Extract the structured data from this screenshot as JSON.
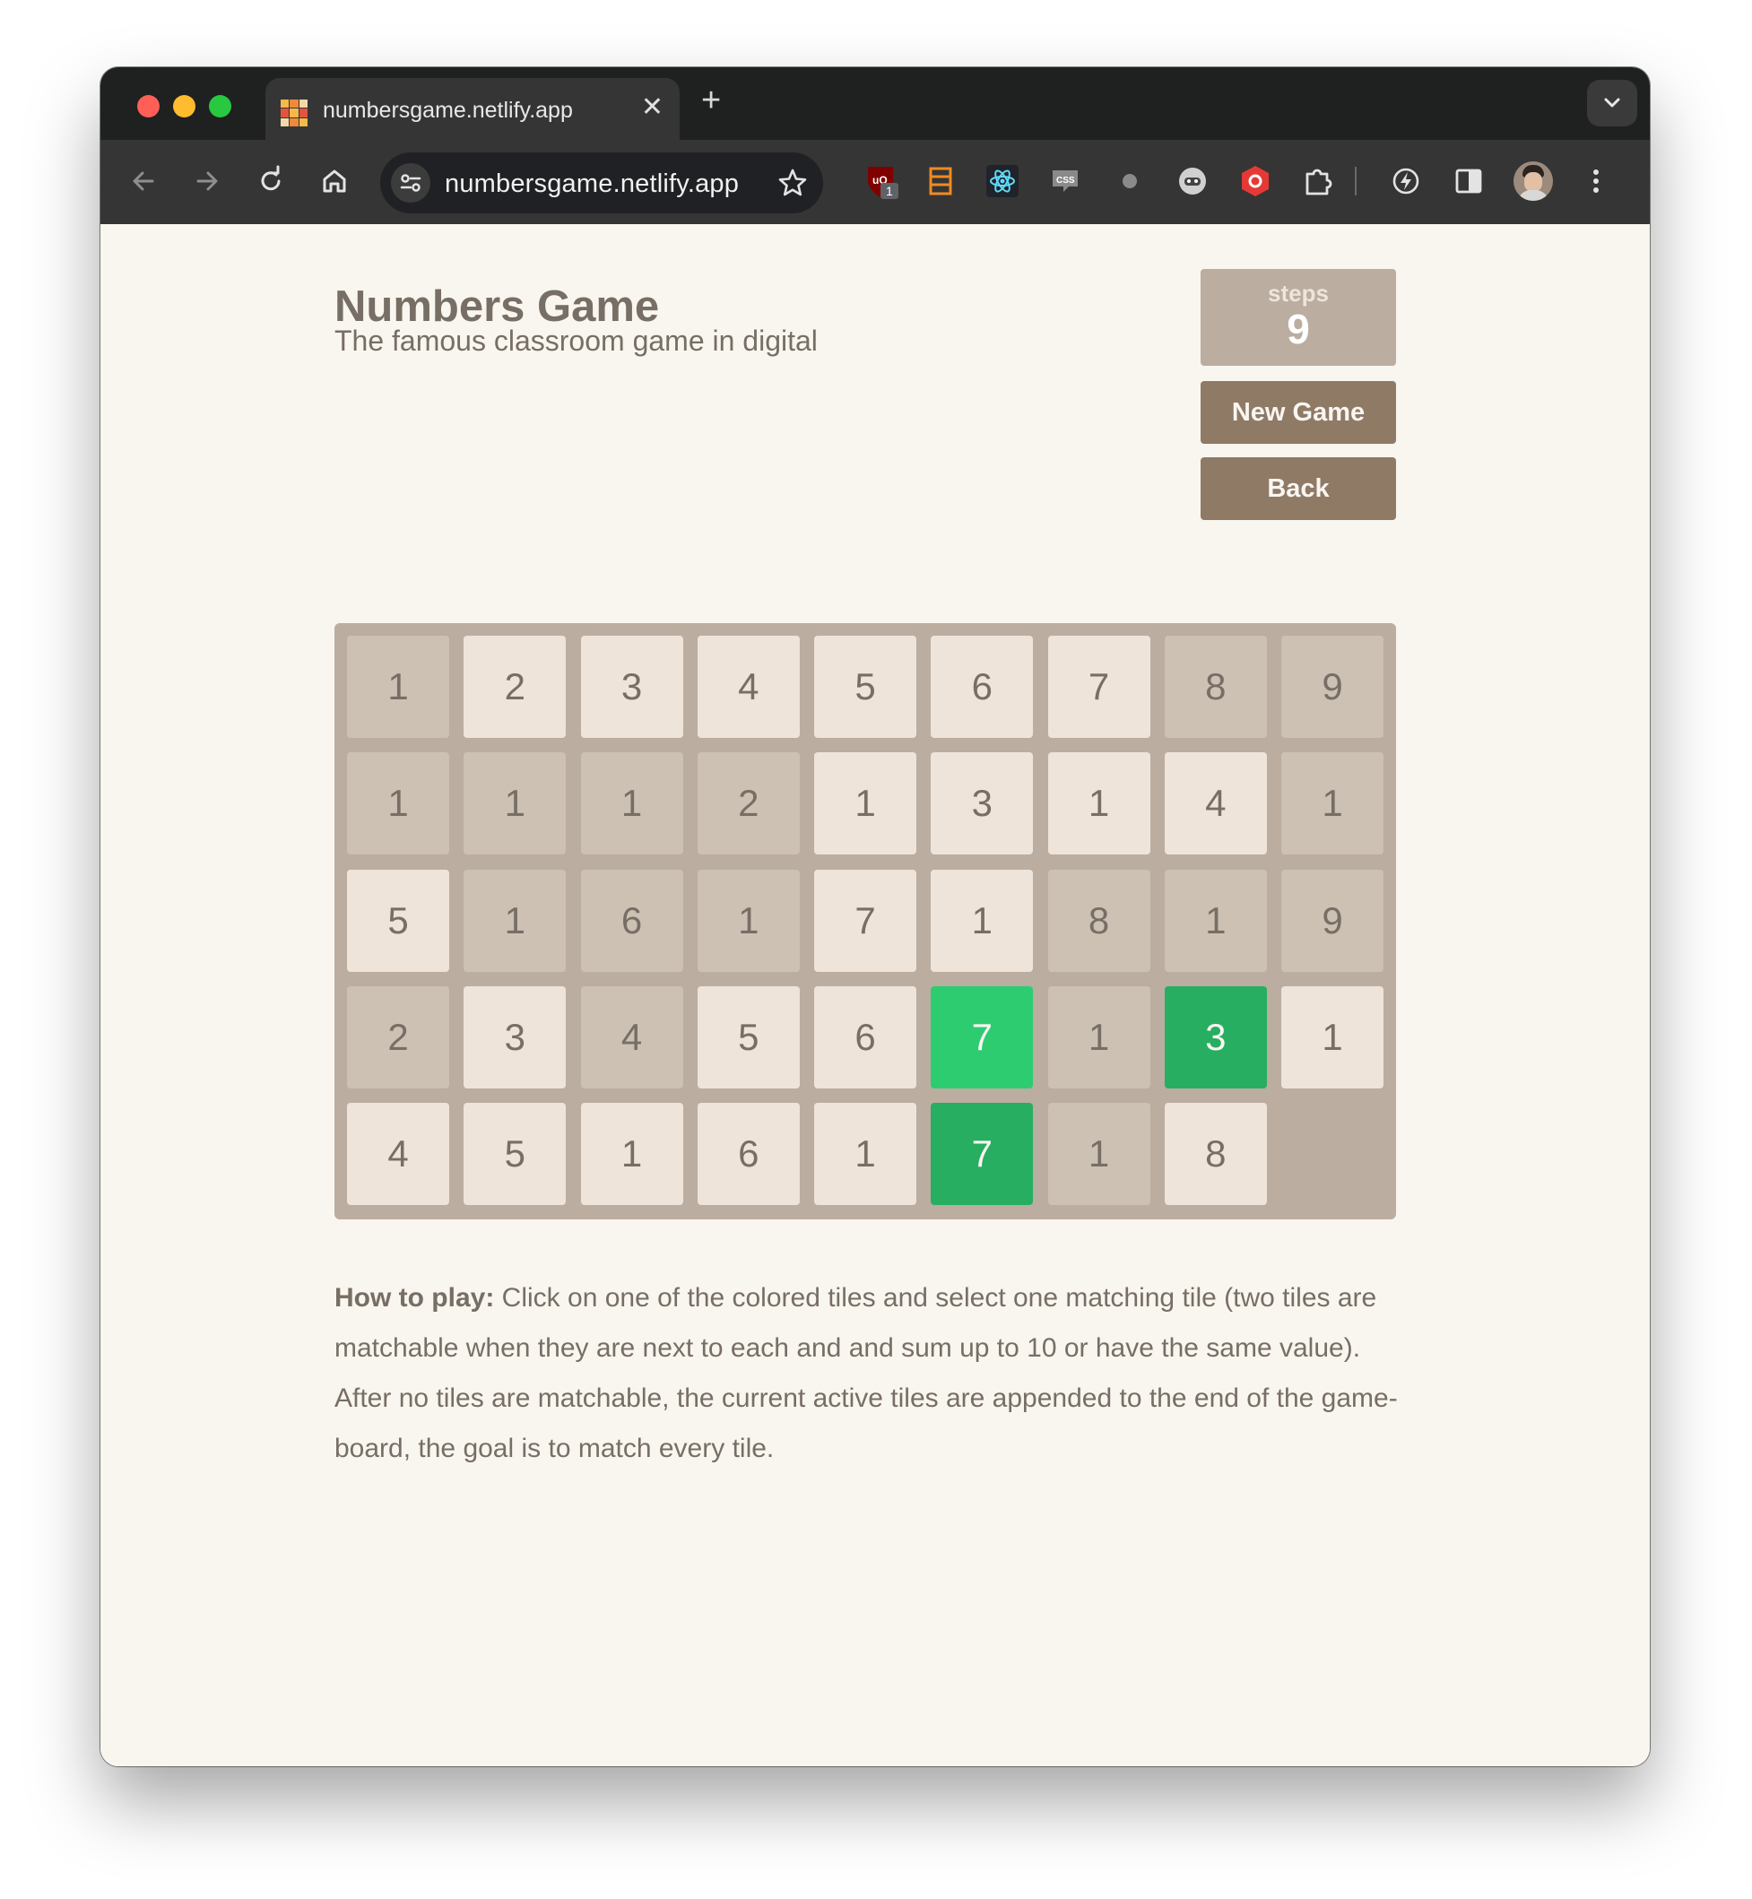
{
  "browser": {
    "tab_title": "numbersgame.netlify.app",
    "url": "numbersgame.netlify.app",
    "extension_badge": "1"
  },
  "header": {
    "title": "Numbers Game",
    "subtitle": "The famous classroom game in digital"
  },
  "score": {
    "label": "steps",
    "value": "9"
  },
  "buttons": {
    "new_game": "New Game",
    "back": "Back"
  },
  "board": {
    "rows": [
      [
        {
          "v": "1",
          "s": "used"
        },
        {
          "v": "2",
          "s": "active"
        },
        {
          "v": "3",
          "s": "active"
        },
        {
          "v": "4",
          "s": "active"
        },
        {
          "v": "5",
          "s": "active"
        },
        {
          "v": "6",
          "s": "active"
        },
        {
          "v": "7",
          "s": "active"
        },
        {
          "v": "8",
          "s": "used"
        },
        {
          "v": "9",
          "s": "used"
        }
      ],
      [
        {
          "v": "1",
          "s": "used"
        },
        {
          "v": "1",
          "s": "used"
        },
        {
          "v": "1",
          "s": "used"
        },
        {
          "v": "2",
          "s": "used"
        },
        {
          "v": "1",
          "s": "active"
        },
        {
          "v": "3",
          "s": "active"
        },
        {
          "v": "1",
          "s": "active"
        },
        {
          "v": "4",
          "s": "active"
        },
        {
          "v": "1",
          "s": "used"
        }
      ],
      [
        {
          "v": "5",
          "s": "active"
        },
        {
          "v": "1",
          "s": "used"
        },
        {
          "v": "6",
          "s": "used"
        },
        {
          "v": "1",
          "s": "used"
        },
        {
          "v": "7",
          "s": "active"
        },
        {
          "v": "1",
          "s": "active"
        },
        {
          "v": "8",
          "s": "used"
        },
        {
          "v": "1",
          "s": "used"
        },
        {
          "v": "9",
          "s": "used"
        }
      ],
      [
        {
          "v": "2",
          "s": "used"
        },
        {
          "v": "3",
          "s": "active"
        },
        {
          "v": "4",
          "s": "used"
        },
        {
          "v": "5",
          "s": "active"
        },
        {
          "v": "6",
          "s": "active"
        },
        {
          "v": "7",
          "s": "sel-light"
        },
        {
          "v": "1",
          "s": "used"
        },
        {
          "v": "3",
          "s": "sel-dark"
        },
        {
          "v": "1",
          "s": "active"
        }
      ],
      [
        {
          "v": "4",
          "s": "active"
        },
        {
          "v": "5",
          "s": "active"
        },
        {
          "v": "1",
          "s": "active"
        },
        {
          "v": "6",
          "s": "active"
        },
        {
          "v": "1",
          "s": "active"
        },
        {
          "v": "7",
          "s": "sel-dark"
        },
        {
          "v": "1",
          "s": "used"
        },
        {
          "v": "8",
          "s": "active"
        }
      ]
    ],
    "colors": {
      "active": "#eee4da",
      "used": "#cdc1b4",
      "selected_light": "#2ecc71",
      "selected_dark": "#27ae60",
      "board": "#bbada0"
    }
  },
  "instructions": {
    "heading": "How to play:",
    "body": " Click on one of the colored tiles and select one matching tile (two tiles are matchable when they are next to each and and sum up to 10 or have the same value). After no tiles are matchable, the current active tiles are appended to the end of the game-board, the goal is to match every tile."
  },
  "icons": [
    "back-arrow-icon",
    "forward-arrow-icon",
    "reload-icon",
    "home-icon",
    "site-settings-icon",
    "bookmark-star-icon",
    "ublock-icon",
    "storage-icon",
    "react-devtools-icon",
    "css-icon",
    "circle-icon",
    "bot-icon",
    "shield-icon",
    "puzzle-icon",
    "divider",
    "lightning-icon",
    "sidepanel-icon",
    "profile-avatar",
    "kebab-menu-icon"
  ]
}
